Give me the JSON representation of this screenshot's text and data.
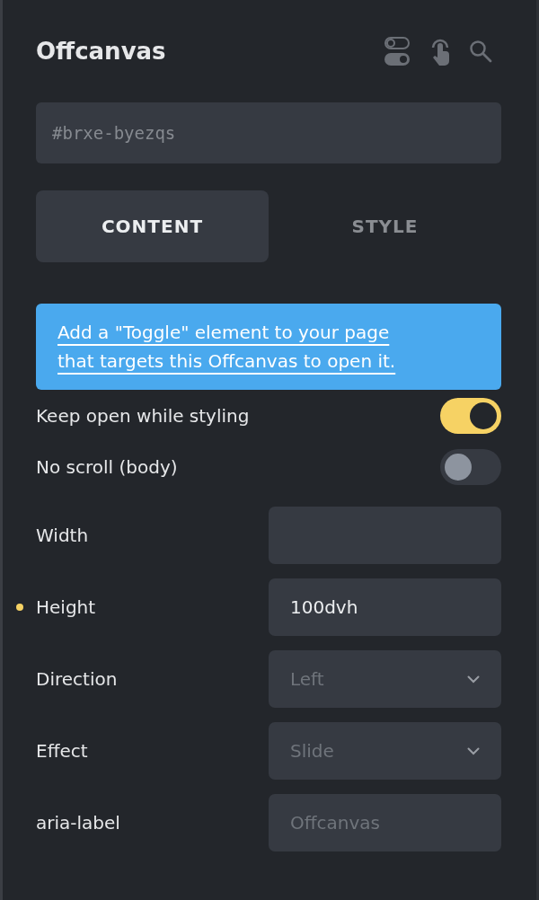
{
  "panel": {
    "title": "Offcanvas"
  },
  "id_field": {
    "placeholder": "#brxe-byezqs"
  },
  "tabs": [
    {
      "label": "CONTENT",
      "selected": true
    },
    {
      "label": "STYLE",
      "selected": false
    }
  ],
  "notice": {
    "text": "Add a \"Toggle\" element to your page that targets this Offcanvas to open it."
  },
  "toggles": [
    {
      "label": "Keep open while styling",
      "on": true
    },
    {
      "label": "No scroll (body)",
      "on": false
    }
  ],
  "settings": [
    {
      "label": "Width",
      "kind": "input",
      "modified": false
    },
    {
      "label": "Height",
      "kind": "input",
      "modified": true,
      "value": "100dvh"
    },
    {
      "label": "Direction",
      "kind": "select",
      "modified": false,
      "placeholder": "Left"
    },
    {
      "label": "Effect",
      "kind": "select",
      "modified": false,
      "placeholder": "Slide"
    },
    {
      "label": "aria-label",
      "kind": "input",
      "modified": false,
      "placeholder": "Offcanvas"
    }
  ]
}
